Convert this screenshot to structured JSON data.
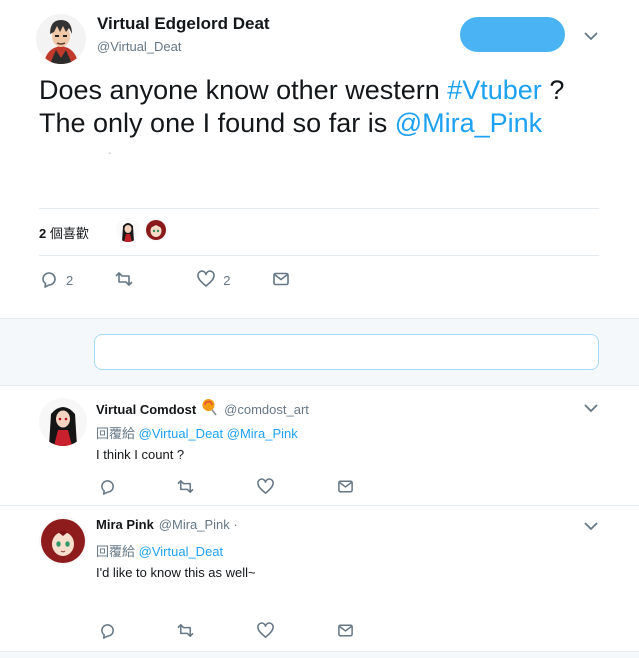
{
  "main_tweet": {
    "author_name": "Virtual Edgelord Deat",
    "author_handle": "@Virtual_Deat",
    "text_line1_pre": "Does anyone know other western ",
    "text_line1_link": "#Vtuber",
    "text_line1_post": " ?",
    "text_line2_pre": "The only one I found so far is ",
    "text_line2_link": "@Mira_Pink",
    "likes_count": "2",
    "likes_label": " 個喜歡",
    "reply_count": "2",
    "retweet_count": "",
    "like_count": "2",
    "tiny_mark": "`"
  },
  "replies": [
    {
      "name": "Virtual Comdost",
      "badge_icon": "lollipop-icon",
      "handle": "@comdost_art",
      "reply_prefix": "回覆給",
      "reply_to_1": "@Virtual_Deat",
      "reply_to_2": "@Mira_Pink",
      "text": "I think I count ?"
    },
    {
      "name": "Mira Pink",
      "handle": "@Mira_Pink ·",
      "reply_prefix": "回覆給",
      "reply_to_1": "@Virtual_Deat",
      "text": "I'd like to know this as well~"
    }
  ],
  "colors": {
    "accent": "#1da1f2",
    "follow_button": "#4ab3f4",
    "muted": "#657786",
    "divider": "#e6ecf0"
  }
}
